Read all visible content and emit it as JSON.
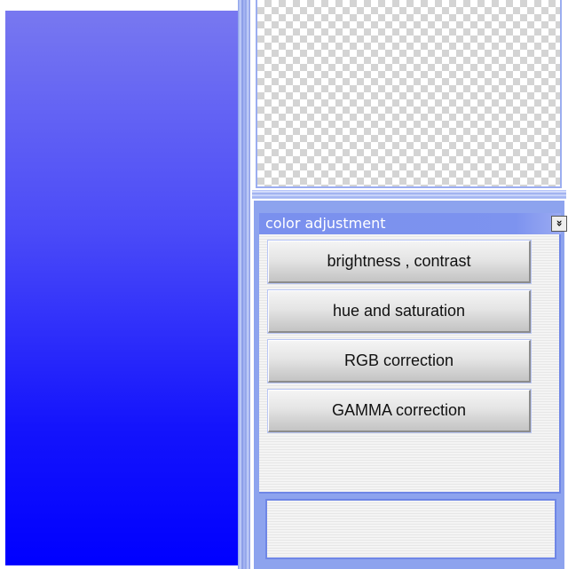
{
  "canvas": {
    "gradient_top_color": "#7878f0",
    "gradient_bottom_color": "#0000ff"
  },
  "preview": {
    "background": "transparency-checkerboard"
  },
  "color_adjustment": {
    "title": "color adjustment",
    "collapse_icon": "double-chevron-down-icon",
    "collapse_glyph": "»",
    "buttons": [
      {
        "label": "brightness , contrast"
      },
      {
        "label": "hue and saturation"
      },
      {
        "label": "RGB correction"
      },
      {
        "label": "GAMMA correction"
      }
    ]
  },
  "colors": {
    "panel_blue": "#8da3ee",
    "header_blue": "#7a90ee",
    "button_face": "#e5e5e5"
  }
}
